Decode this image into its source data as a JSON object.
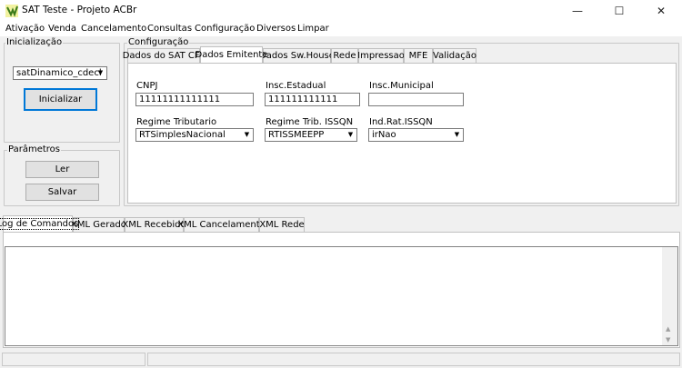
{
  "window": {
    "title": "SAT Teste - Projeto ACBr",
    "minimize_glyph": "—",
    "maximize_glyph": "☐",
    "close_glyph": "✕",
    "icon": "acbr-app-icon"
  },
  "menu": [
    {
      "label": "Ativação"
    },
    {
      "label": "Venda"
    },
    {
      "label": "Cancelamento"
    },
    {
      "label": "Consultas"
    },
    {
      "label": "Configuração"
    },
    {
      "label": "Diversos"
    },
    {
      "label": "Limpar"
    }
  ],
  "inicializacao": {
    "legend": "Inicialização",
    "library_combo_value": "satDinamico_cdecl",
    "init_button": "Inicializar"
  },
  "parametros": {
    "legend": "Parâmetros",
    "read_button": "Ler",
    "save_button": "Salvar"
  },
  "configuracao": {
    "legend": "Configuração",
    "tabs": [
      {
        "label": "Dados do SAT CFe"
      },
      {
        "label": "Dados Emitente"
      },
      {
        "label": "Dados Sw.House"
      },
      {
        "label": "Rede"
      },
      {
        "label": "Impressao"
      },
      {
        "label": "MFE"
      },
      {
        "label": "Validação"
      }
    ],
    "active_tab": "Dados Emitente",
    "emitente": {
      "cnpj_label": "CNPJ",
      "cnpj_value": "11111111111111",
      "ie_label": "Insc.Estadual",
      "ie_value": "111111111111",
      "im_label": "Insc.Municipal",
      "im_value": "",
      "regime_trib_label": "Regime Tributario",
      "regime_trib_value": "RTSimplesNacional",
      "regime_issqn_label": "Regime Trib. ISSQN",
      "regime_issqn_value": "RTISSMEEPP",
      "ind_rat_label": "Ind.Rat.ISSQN",
      "ind_rat_value": "irNao"
    }
  },
  "log": {
    "tabs": [
      {
        "label": "Log de Comandos"
      },
      {
        "label": "XML Gerado"
      },
      {
        "label": "XML Recebido"
      },
      {
        "label": "XML Cancelamento"
      },
      {
        "label": "XML Rede"
      }
    ],
    "active_tab": "Log de Comandos",
    "scroll_up_glyph": "▲",
    "scroll_down_glyph": "▼"
  },
  "combo_arrow_glyph": "▼"
}
